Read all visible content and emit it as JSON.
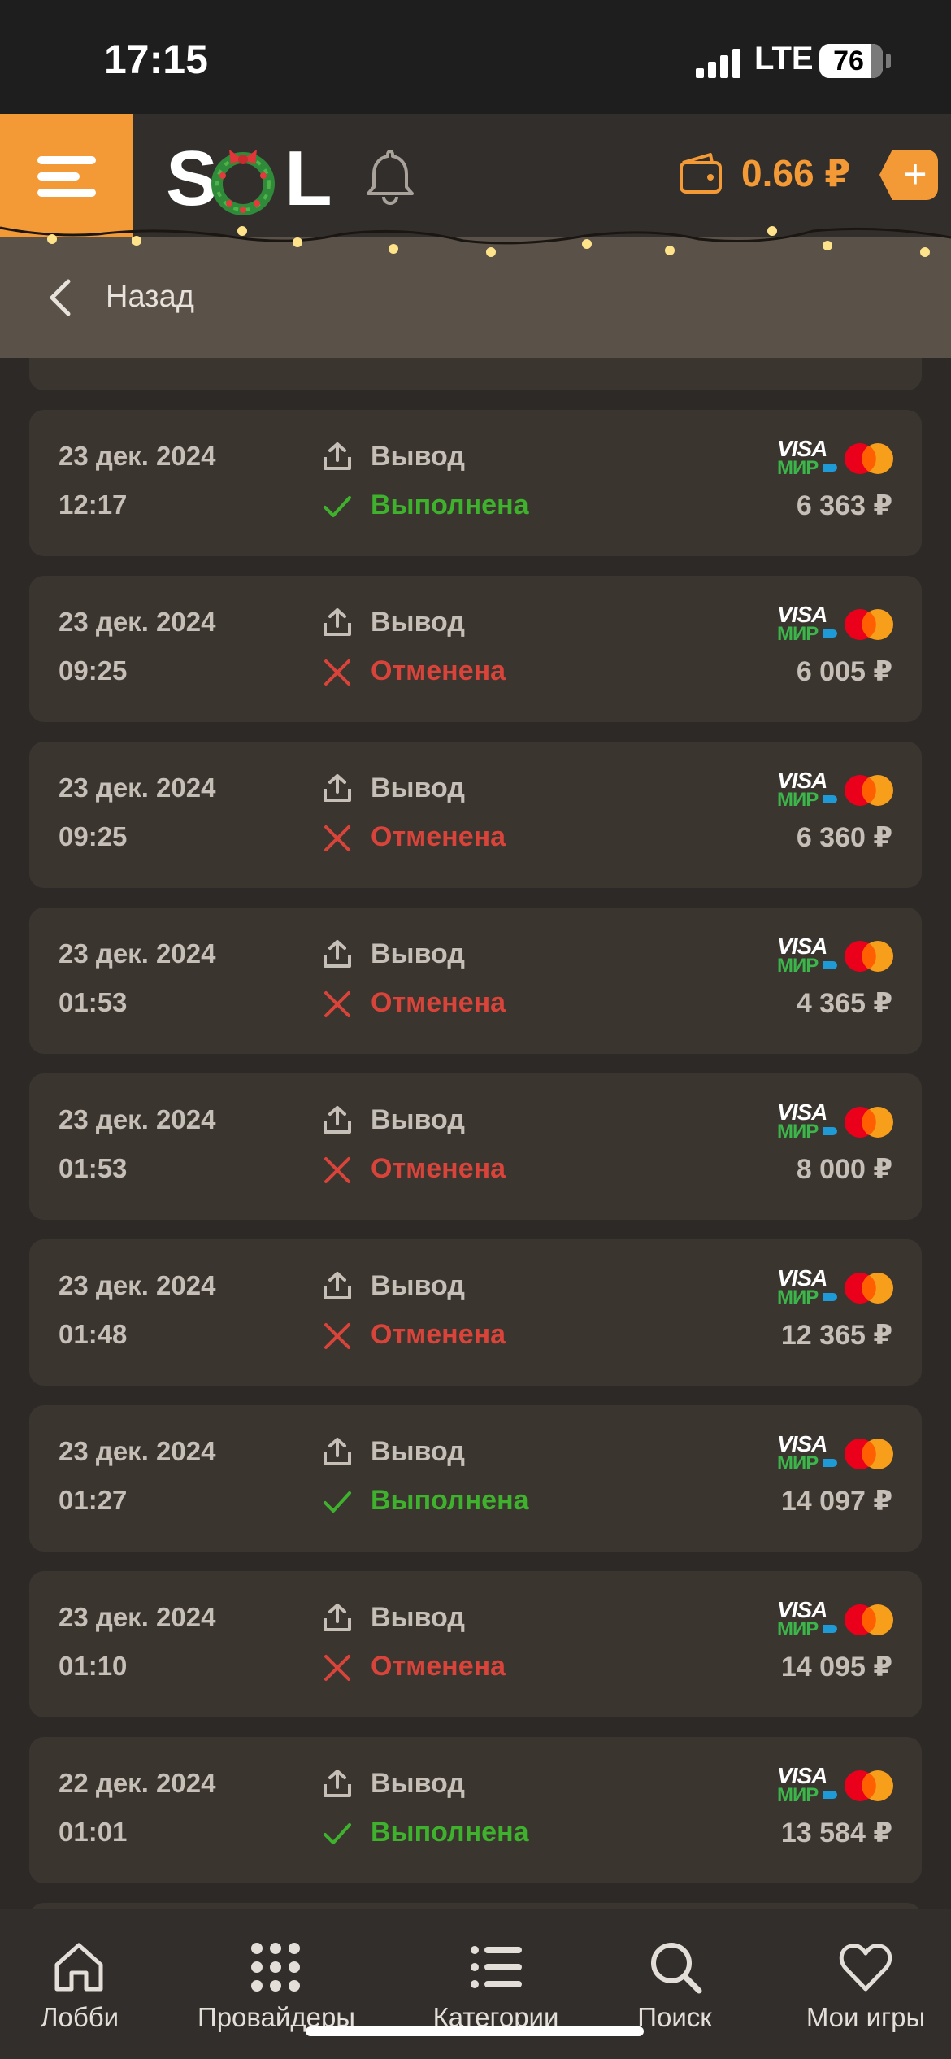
{
  "status_bar": {
    "time": "17:15",
    "network": "LTE",
    "battery": "76"
  },
  "header": {
    "logo_left": "S",
    "logo_right": "L",
    "balance": "0.66 ₽",
    "add_label": "+",
    "icons": [
      "menu-icon",
      "bell-icon",
      "wallet-icon",
      "plus-icon"
    ],
    "accent_color": "#f39a36"
  },
  "back_bar": {
    "label": "Назад"
  },
  "transactions": [
    {
      "date": "23 дек. 2024",
      "time": "12:17",
      "type": "Вывод",
      "status": "Выполнена",
      "status_kind": "ok",
      "amount": "6 363 ₽"
    },
    {
      "date": "23 дек. 2024",
      "time": "09:25",
      "type": "Вывод",
      "status": "Отменена",
      "status_kind": "fail",
      "amount": "6 005 ₽"
    },
    {
      "date": "23 дек. 2024",
      "time": "09:25",
      "type": "Вывод",
      "status": "Отменена",
      "status_kind": "fail",
      "amount": "6 360 ₽"
    },
    {
      "date": "23 дек. 2024",
      "time": "01:53",
      "type": "Вывод",
      "status": "Отменена",
      "status_kind": "fail",
      "amount": "4 365 ₽"
    },
    {
      "date": "23 дек. 2024",
      "time": "01:53",
      "type": "Вывод",
      "status": "Отменена",
      "status_kind": "fail",
      "amount": "8 000 ₽"
    },
    {
      "date": "23 дек. 2024",
      "time": "01:48",
      "type": "Вывод",
      "status": "Отменена",
      "status_kind": "fail",
      "amount": "12 365 ₽"
    },
    {
      "date": "23 дек. 2024",
      "time": "01:27",
      "type": "Вывод",
      "status": "Выполнена",
      "status_kind": "ok",
      "amount": "14 097 ₽"
    },
    {
      "date": "23 дек. 2024",
      "time": "01:10",
      "type": "Вывод",
      "status": "Отменена",
      "status_kind": "fail",
      "amount": "14 095 ₽"
    },
    {
      "date": "22 дек. 2024",
      "time": "01:01",
      "type": "Вывод",
      "status": "Выполнена",
      "status_kind": "ok",
      "amount": "13 584 ₽"
    }
  ],
  "payment_logos": {
    "visa": "VISA",
    "mir": "МИР"
  },
  "status_colors": {
    "ok": "#3fb22d",
    "fail": "#d9443a"
  },
  "bottom_nav": [
    {
      "label": "Лобби",
      "icon": "home-icon"
    },
    {
      "label": "Провайдеры",
      "icon": "grid-icon"
    },
    {
      "label": "Категории",
      "icon": "list-icon"
    },
    {
      "label": "Поиск",
      "icon": "search-icon"
    },
    {
      "label": "Мои игры",
      "icon": "heart-icon"
    }
  ]
}
